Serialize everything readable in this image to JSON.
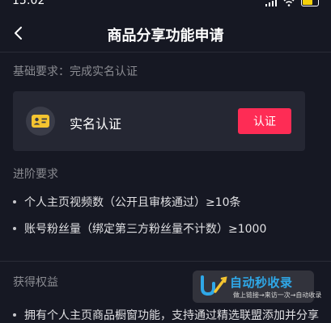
{
  "status_bar": {
    "time": "15:02"
  },
  "nav": {
    "title": "商品分享功能申请"
  },
  "basic": {
    "label": "基础要求：完成实名认证",
    "card_title": "实名认证",
    "verify_button": "认证"
  },
  "advanced": {
    "label": "进阶要求",
    "items": [
      "个人主页视频数（公开且审核通过）≥10条",
      "账号粉丝量（绑定第三方粉丝量不计数）≥1000"
    ]
  },
  "rights": {
    "label": "获得权益",
    "items": [
      "拥有个人主页商品橱窗功能，支持通过精选联盟添加并分享"
    ]
  },
  "watermark": {
    "title": "自动秒收录",
    "tagline": "做上链接→来访一次→自动收录"
  },
  "colors": {
    "background": "#161823",
    "card": "#252733",
    "accent": "#fe2c55",
    "secondary_text": "#8a8b91"
  }
}
